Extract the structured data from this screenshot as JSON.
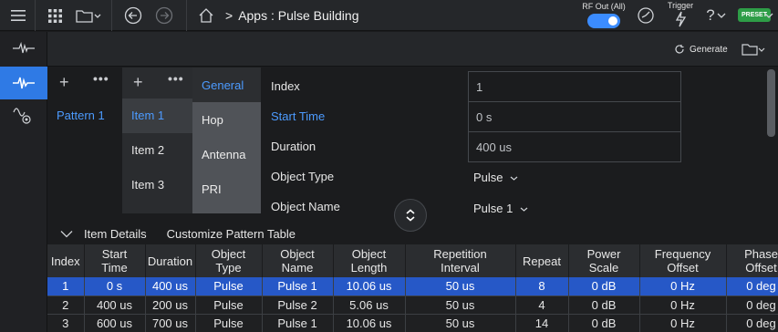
{
  "topbar": {
    "breadcrumb_sep": ">",
    "breadcrumb": "Apps : Pulse Building",
    "rf_label": "RF Out (All)",
    "rf_on": true,
    "trigger_label": "Trigger",
    "help": "?",
    "preset": "PRESET"
  },
  "toolbar": {
    "generate_label": "Generate"
  },
  "patterns": {
    "add": "+",
    "more": "•••",
    "items": [
      "Pattern 1"
    ]
  },
  "items": {
    "add": "+",
    "more": "•••",
    "list": [
      "Item 1",
      "Item 2",
      "Item 3"
    ],
    "selected": "Item 1"
  },
  "tabs": [
    "General",
    "Hop",
    "Antenna",
    "PRI"
  ],
  "properties": {
    "index_label": "Index",
    "index_value": "1",
    "start_time_label": "Start Time",
    "start_time_value": "0 s",
    "duration_label": "Duration",
    "duration_value": "400 us",
    "object_type_label": "Object Type",
    "object_type_value": "Pulse",
    "object_name_label": "Object Name",
    "object_name_value": "Pulse 1"
  },
  "details": {
    "item_details": "Item Details",
    "customize": "Customize Pattern Table"
  },
  "table": {
    "headers": [
      [
        "Index",
        ""
      ],
      [
        "Start",
        "Time"
      ],
      [
        "Duration",
        ""
      ],
      [
        "Object",
        "Type"
      ],
      [
        "Object",
        "Name"
      ],
      [
        "Object",
        "Length"
      ],
      [
        "Repetition",
        "Interval"
      ],
      [
        "Repeat",
        ""
      ],
      [
        "Power",
        "Scale"
      ],
      [
        "Frequency",
        "Offset"
      ],
      [
        "Phase",
        "Offset"
      ]
    ],
    "rows": [
      [
        "1",
        "0 s",
        "400 us",
        "Pulse",
        "Pulse 1",
        "10.06 us",
        "50 us",
        "8",
        "0 dB",
        "0 Hz",
        "0 deg"
      ],
      [
        "2",
        "400 us",
        "200 us",
        "Pulse",
        "Pulse 2",
        "5.06 us",
        "50 us",
        "4",
        "0 dB",
        "0 Hz",
        "0 deg"
      ],
      [
        "3",
        "600 us",
        "700 us",
        "Pulse",
        "Pulse 1",
        "10.06 us",
        "50 us",
        "14",
        "0 dB",
        "0 Hz",
        "0 deg"
      ]
    ]
  },
  "colors": {
    "accent": "#2f7ae5",
    "selected_row": "#2658c7",
    "preset_green": "#2e9d47"
  }
}
